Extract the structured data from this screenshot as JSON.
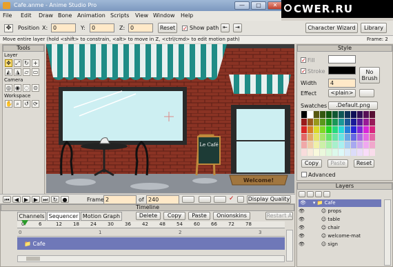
{
  "window": {
    "title": "Cafe.anme - Anime Studio Pro",
    "min": "—",
    "max": "□",
    "close": "✕"
  },
  "watermark": "CWER.RU",
  "menu": [
    "File",
    "Edit",
    "Draw",
    "Bone",
    "Animation",
    "Scripts",
    "View",
    "Window",
    "Help"
  ],
  "toolbar": {
    "position_label": "Position",
    "x_label": "X:",
    "x_value": "0",
    "y_label": "Y:",
    "y_value": "0",
    "z_label": "Z:",
    "z_value": "0",
    "reset": "Reset",
    "show_path": "Show path",
    "character_wizard": "Character Wizard",
    "library": "Library"
  },
  "status": {
    "hint": "Move entire layer (hold <shift> to constrain, <alt> to move in Z, <ctrl/cmd> to edit motion path)",
    "frame": "Frame: 2"
  },
  "tools": {
    "title": "Tools",
    "layer": "Layer",
    "camera": "Camera",
    "workspace": "Workspace"
  },
  "canvas": {
    "sign_text": "Le Café",
    "mat_text": "Welcome!"
  },
  "style": {
    "title": "Style",
    "fill": "Fill",
    "stroke": "Stroke",
    "no_brush": "No\nBrush",
    "width_label": "Width",
    "width_value": "4",
    "effect_label": "Effect",
    "effect_value": "<plain>",
    "swatches_label": "Swatches",
    "swatches_value": ".Default.png",
    "copy": "Copy",
    "paste": "Paste",
    "reset": "Reset",
    "advanced": "Advanced"
  },
  "layers": {
    "title": "Layers",
    "group": "Cafe",
    "items": [
      "props",
      "table",
      "chair",
      "welcome-mat",
      "sign"
    ]
  },
  "playbar": {
    "frame_label": "Frame",
    "frame_value": "2",
    "of": "of",
    "total": "240",
    "display": "Display Quality"
  },
  "timeline": {
    "title": "Timeline",
    "tabs": [
      "Channels",
      "Sequencer",
      "Motion Graph"
    ],
    "delete": "Delete",
    "copy": "Copy",
    "paste": "Paste",
    "onionskins": "Onionskins",
    "restart": "Restart A",
    "ruler": [
      "0",
      "6",
      "12",
      "18",
      "24",
      "30",
      "36",
      "42",
      "48",
      "54",
      "60",
      "66",
      "72",
      "78"
    ],
    "sub_ruler": [
      "0",
      "1",
      "2",
      "3"
    ],
    "track": "Cafe"
  },
  "colors": {
    "accent": "#7c98bf",
    "layer_sel": "#6f78b8",
    "brick": "#8a3324",
    "awning": "#1f8c86"
  }
}
